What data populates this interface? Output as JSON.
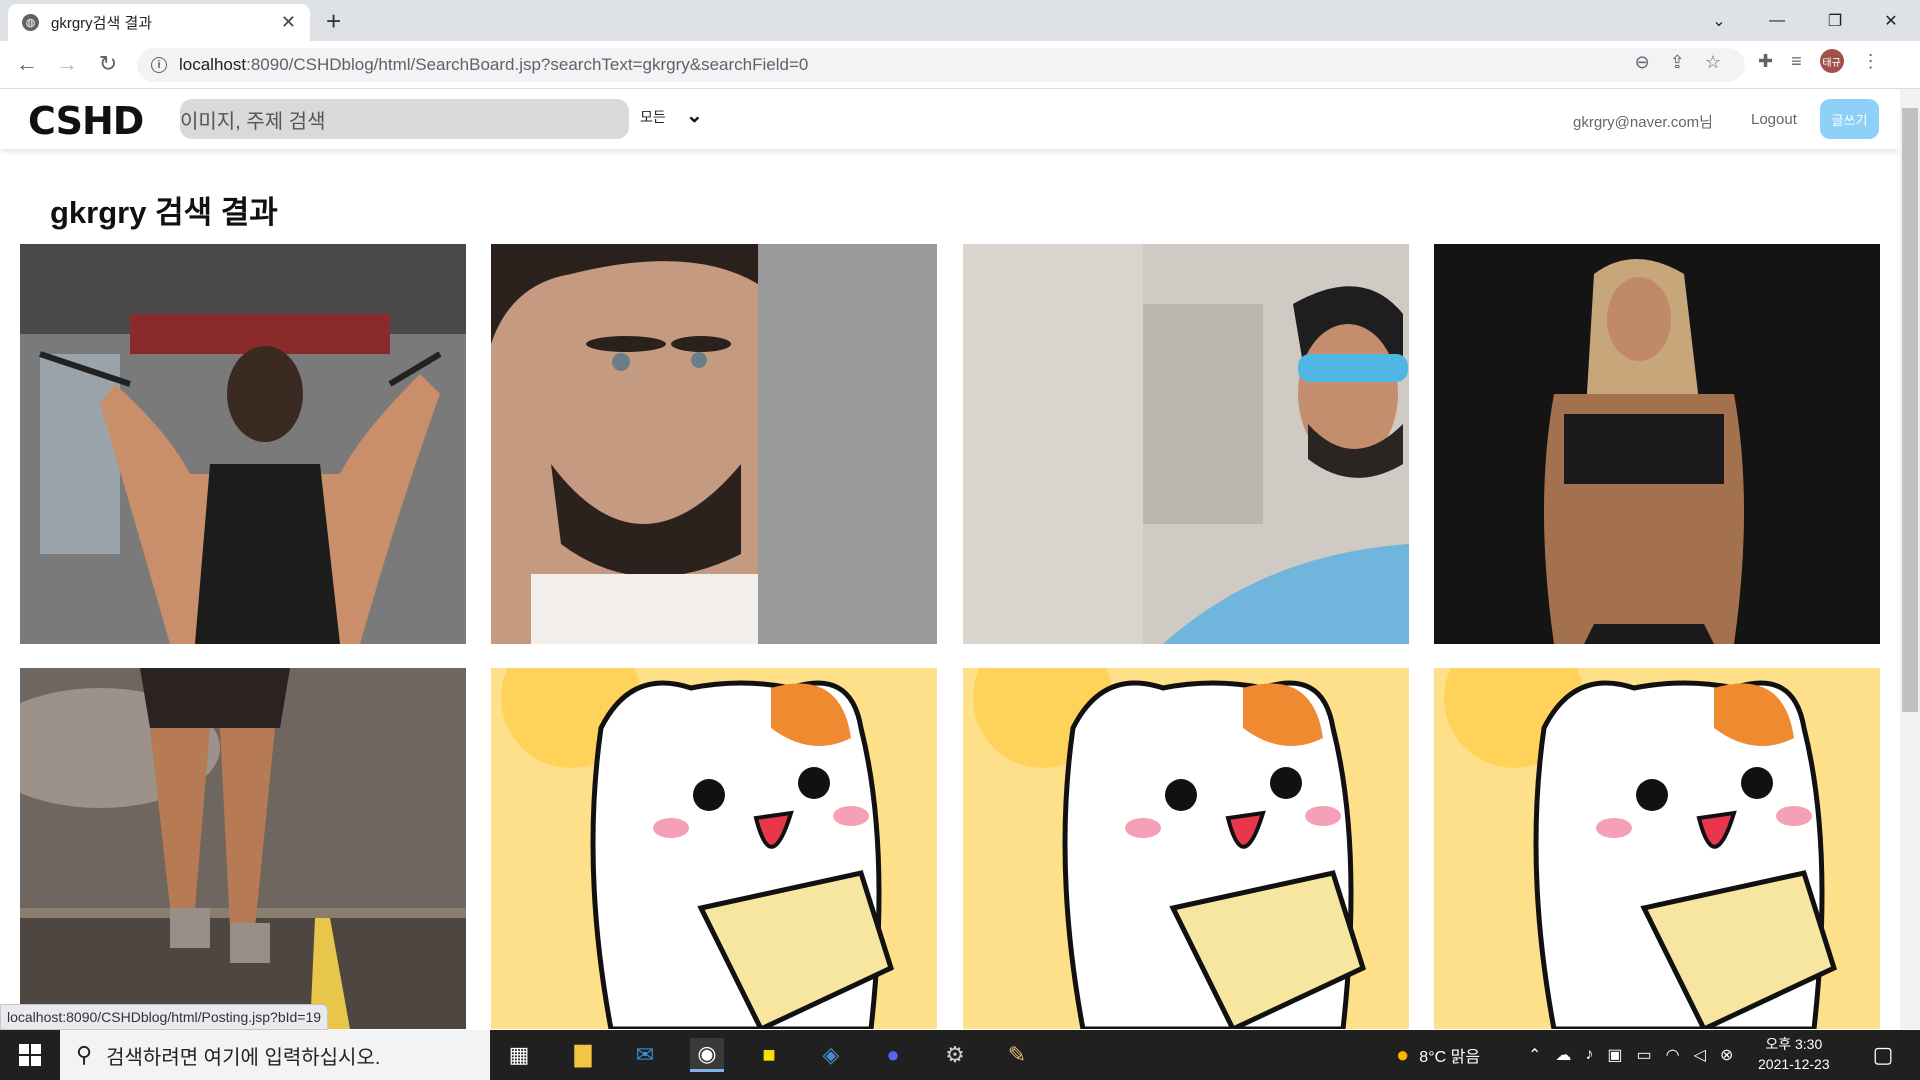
{
  "browser": {
    "tab_title": "gkrgry검색 결과",
    "url_host": "localhost",
    "url_rest": ":8090/CSHDblog/html/SearchBoard.jsp?searchText=gkrgry&searchField=0",
    "profile_initials": "태규"
  },
  "site": {
    "logo": "CSHD",
    "search_placeholder": "이미지, 주제 검색",
    "field_select": "모든",
    "user_label": "gkrgry@naver.com님",
    "logout": "Logout",
    "write": "글쓰기",
    "heading": "gkrgry 검색 결과"
  },
  "results": [
    {
      "subject": "man at gym cable machine",
      "bg": "#6b6b6b"
    },
    {
      "subject": "bearded man portrait",
      "bg": "#9a9a9a"
    },
    {
      "subject": "man with sunglasses",
      "bg": "#c9c4bd"
    },
    {
      "subject": "fitness woman dark",
      "bg": "#141414"
    },
    {
      "subject": "runner legs on road",
      "bg": "#8a7a6a"
    },
    {
      "subject": "cartoon hamster",
      "bg": "#ffe08a"
    },
    {
      "subject": "cartoon hamster",
      "bg": "#ffe08a"
    },
    {
      "subject": "cartoon hamster",
      "bg": "#ffe08a"
    }
  ],
  "status_url": "localhost:8090/CSHDblog/html/Posting.jsp?bId=19",
  "taskbar": {
    "search_placeholder": "검색하려면 여기에 입력하십시오.",
    "weather": "8°C 맑음",
    "time": "오후 3:30",
    "date": "2021-12-23"
  }
}
